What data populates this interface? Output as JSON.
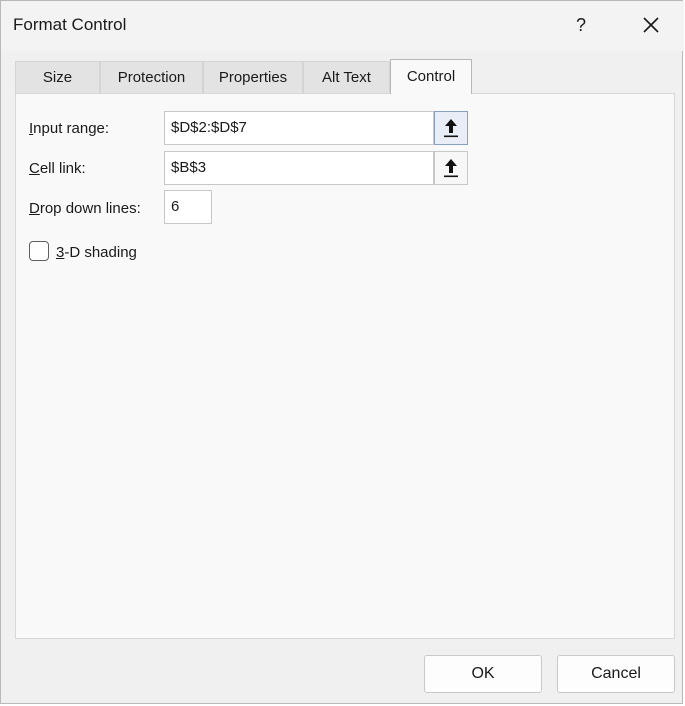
{
  "window": {
    "title": "Format Control",
    "help_label": "?"
  },
  "tabs": [
    {
      "label": "Size",
      "active": false
    },
    {
      "label": "Protection",
      "active": false
    },
    {
      "label": "Properties",
      "active": false
    },
    {
      "label": "Alt Text",
      "active": false
    },
    {
      "label": "Control",
      "active": true
    }
  ],
  "control": {
    "input_range": {
      "label_accel": "I",
      "label_rest": "nput range:",
      "value": "$D$2:$D$7"
    },
    "cell_link": {
      "label_accel": "C",
      "label_rest": "ell link:",
      "value": "$B$3"
    },
    "drop_down_lines": {
      "label_accel": "D",
      "label_rest": "rop down lines:",
      "value": "6"
    },
    "shading": {
      "label_accel": "3",
      "label_rest": "-D shading",
      "checked": false
    }
  },
  "buttons": {
    "ok": "OK",
    "cancel": "Cancel"
  }
}
